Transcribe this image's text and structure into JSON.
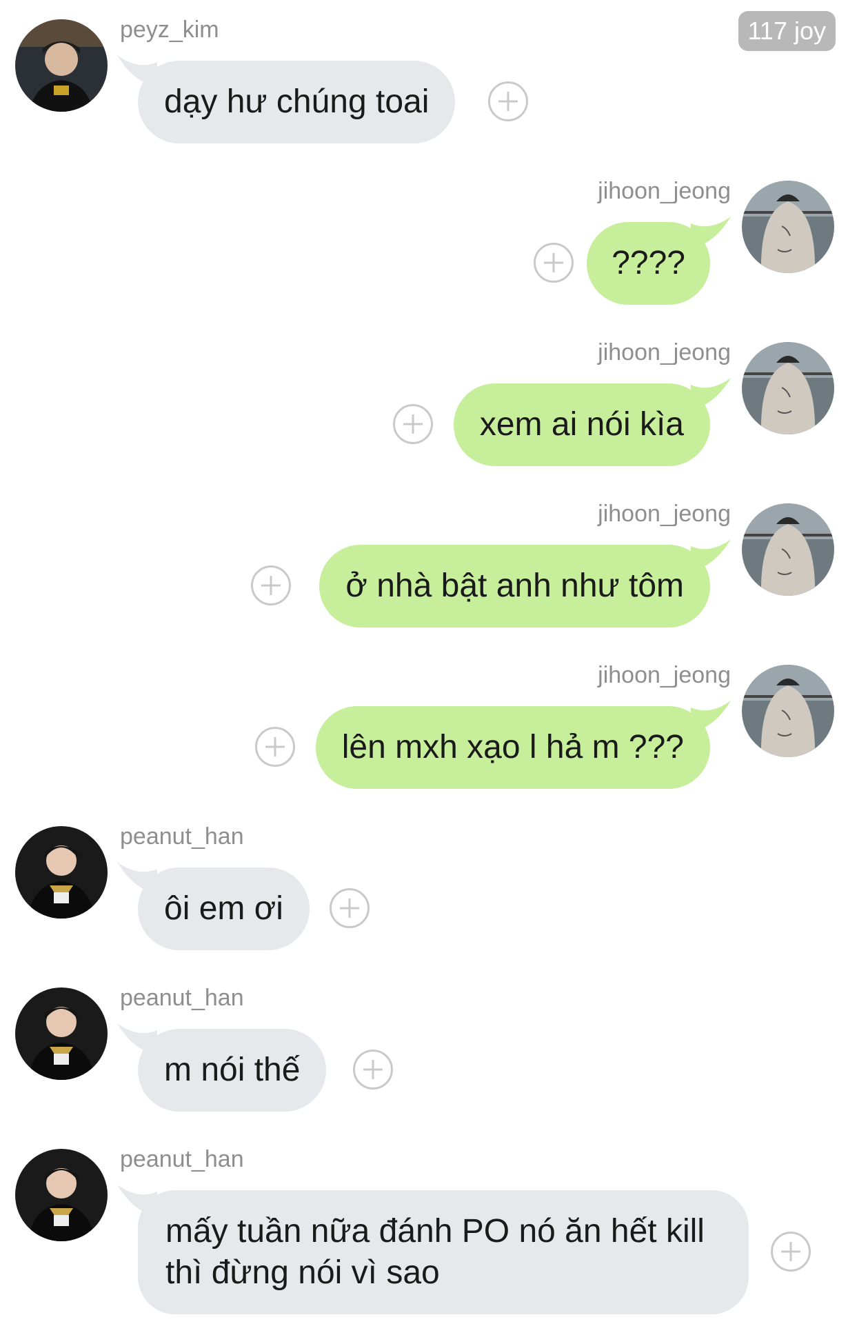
{
  "badge": "117 joy",
  "messages": [
    {
      "user": "peyz_kim",
      "text": "dạy hư chúng toai",
      "side": "left"
    },
    {
      "user": "jihoon_jeong",
      "text": "????",
      "side": "right"
    },
    {
      "user": "jihoon_jeong",
      "text": "xem ai nói kìa",
      "side": "right"
    },
    {
      "user": "jihoon_jeong",
      "text": "ở nhà bật anh như tôm",
      "side": "right"
    },
    {
      "user": "jihoon_jeong",
      "text": "lên mxh xạo l hả m ???",
      "side": "right"
    },
    {
      "user": "peanut_han",
      "text": "ôi em ơi",
      "side": "left"
    },
    {
      "user": "peanut_han",
      "text": "m nói thế",
      "side": "left"
    },
    {
      "user": "peanut_han",
      "text": "mấy tuần nữa đánh PO nó ăn hết kill thì đừng nói vì sao",
      "side": "left"
    }
  ],
  "colors": {
    "incoming_bubble": "#e6e8ec",
    "outgoing_bubble": "#c7ee9a",
    "username": "#8e8e8e",
    "badge_bg": "#b8b8b8"
  }
}
